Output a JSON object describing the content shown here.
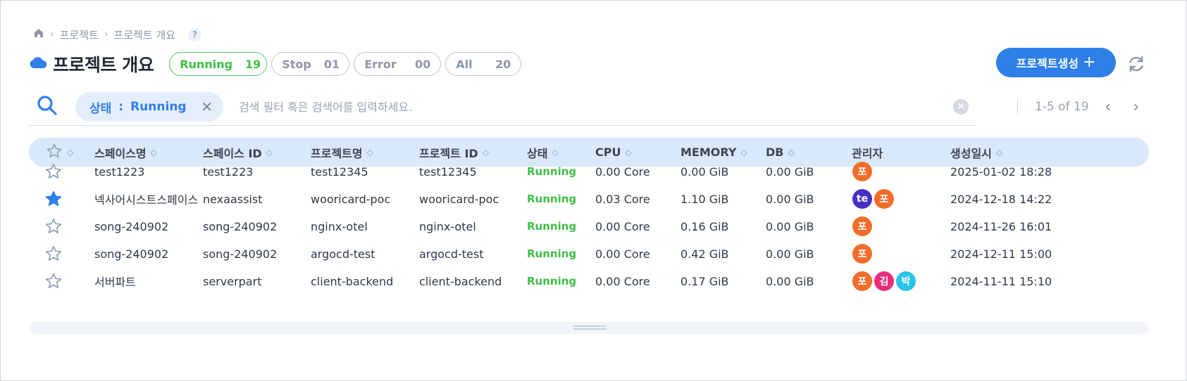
{
  "breadcrumb": {
    "items": [
      "프로젝트",
      "프로젝트 개요"
    ],
    "help": "?"
  },
  "header": {
    "title": "프로젝트 개요"
  },
  "status_filters": [
    {
      "label": "Running",
      "count": "19",
      "active": true
    },
    {
      "label": "Stop",
      "count": "01",
      "active": false
    },
    {
      "label": "Error",
      "count": "00",
      "active": false
    },
    {
      "label": "All",
      "count": "20",
      "active": false
    }
  ],
  "toolbar": {
    "create_label": "프로젝트생성",
    "create_plus": "+"
  },
  "search": {
    "chip_key": "상태",
    "chip_sep": ":",
    "chip_value": "Running",
    "placeholder": "검색 필터 혹은 검색어를 입력하세요."
  },
  "pagination": {
    "range": "1-5 of 19"
  },
  "table": {
    "columns": [
      "스페이스명",
      "스페이스 ID",
      "프로젝트명",
      "프로젝트 ID",
      "상태",
      "CPU",
      "MEMORY",
      "DB",
      "관리자",
      "생성일시"
    ],
    "rows": [
      {
        "starred": false,
        "space_name": "test1223",
        "space_id": "test1223",
        "project_name": "test12345",
        "project_id": "test12345",
        "status": "Running",
        "cpu": "0.00 Core",
        "memory": "0.00 GiB",
        "db": "0.00 GiB",
        "admins": [
          {
            "text": "포",
            "color": "#f26d2b"
          }
        ],
        "created": "2025-01-02 18:28"
      },
      {
        "starred": true,
        "space_name": "넥사어시스트스페이스",
        "space_id": "nexaassist",
        "project_name": "wooricard-poc",
        "project_id": "wooricard-poc",
        "status": "Running",
        "cpu": "0.03 Core",
        "memory": "1.10 GiB",
        "db": "0.00 GiB",
        "admins": [
          {
            "text": "te",
            "color": "#4a2fc7"
          },
          {
            "text": "포",
            "color": "#f26d2b"
          }
        ],
        "created": "2024-12-18 14:22"
      },
      {
        "starred": false,
        "space_name": "song-240902",
        "space_id": "song-240902",
        "project_name": "nginx-otel",
        "project_id": "nginx-otel",
        "status": "Running",
        "cpu": "0.00 Core",
        "memory": "0.16 GiB",
        "db": "0.00 GiB",
        "admins": [
          {
            "text": "포",
            "color": "#f26d2b"
          }
        ],
        "created": "2024-11-26 16:01"
      },
      {
        "starred": false,
        "space_name": "song-240902",
        "space_id": "song-240902",
        "project_name": "argocd-test",
        "project_id": "argocd-test",
        "status": "Running",
        "cpu": "0.00 Core",
        "memory": "0.42 GiB",
        "db": "0.00 GiB",
        "admins": [
          {
            "text": "포",
            "color": "#f26d2b"
          }
        ],
        "created": "2024-12-11 15:00"
      },
      {
        "starred": false,
        "space_name": "서버파트",
        "space_id": "serverpart",
        "project_name": "client-backend",
        "project_id": "client-backend",
        "status": "Running",
        "cpu": "0.00 Core",
        "memory": "0.17 GiB",
        "db": "0.00 GiB",
        "admins": [
          {
            "text": "포",
            "color": "#f26d2b"
          },
          {
            "text": "김",
            "color": "#ec2d7f"
          },
          {
            "text": "박",
            "color": "#2bc3e8"
          }
        ],
        "created": "2024-11-11 15:10"
      }
    ]
  },
  "colors": {
    "accent": "#2f7fe8",
    "running": "#3fbf45",
    "header_bg": "#d9e8fb"
  },
  "icons": [
    "home-icon",
    "cloud-icon",
    "refresh-icon",
    "search-icon",
    "close-icon",
    "clear-icon",
    "star-icon",
    "sort-icon",
    "chevron-left-icon",
    "chevron-right-icon"
  ]
}
